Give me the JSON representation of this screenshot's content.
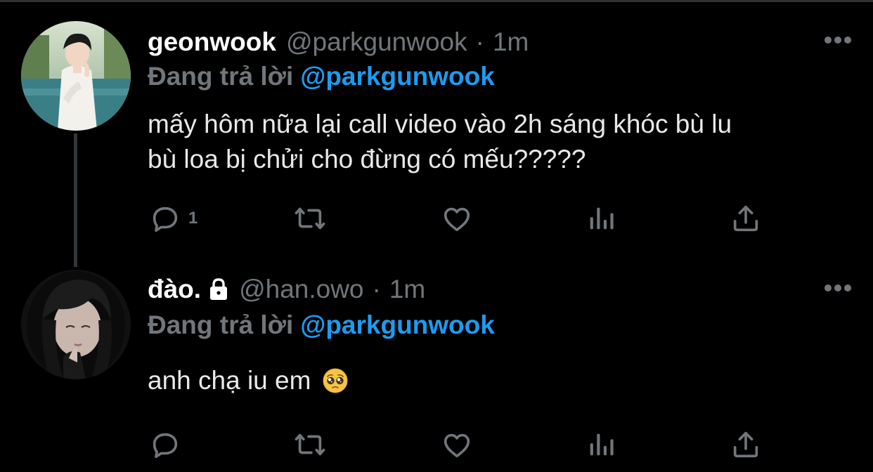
{
  "tweets": [
    {
      "display_name": "geonwook",
      "handle": "@parkgunwook",
      "separator": "·",
      "time": "1m",
      "reply_prefix": "Đang trả lời",
      "reply_mention": "@parkgunwook",
      "text_lines": [
        "mấy hôm nữa lại call video vào 2h sáng khóc bù lu",
        "bù loa bị chửi cho đừng có mếu?????"
      ],
      "reply_count": "1",
      "avatar": "profile-photo"
    },
    {
      "display_name": "đào.",
      "protected_icon": "lock-icon",
      "handle": "@han.owo",
      "separator": "·",
      "time": "1m",
      "reply_prefix": "Đang trả lời",
      "reply_mention": "@parkgunwook",
      "text": "anh chạ iu em",
      "emoji": "pleading-face-emoji",
      "reply_count": "",
      "avatar": "profile-photo"
    }
  ],
  "actions": [
    "reply-icon",
    "retweet-icon",
    "like-icon",
    "stats-icon",
    "share-icon"
  ],
  "more_icon": "more-icon",
  "colors": {
    "background": "#000000",
    "text": "#e7e9ea",
    "muted": "#71767b",
    "accent": "#1d9bf0",
    "thread_line": "#333639"
  }
}
